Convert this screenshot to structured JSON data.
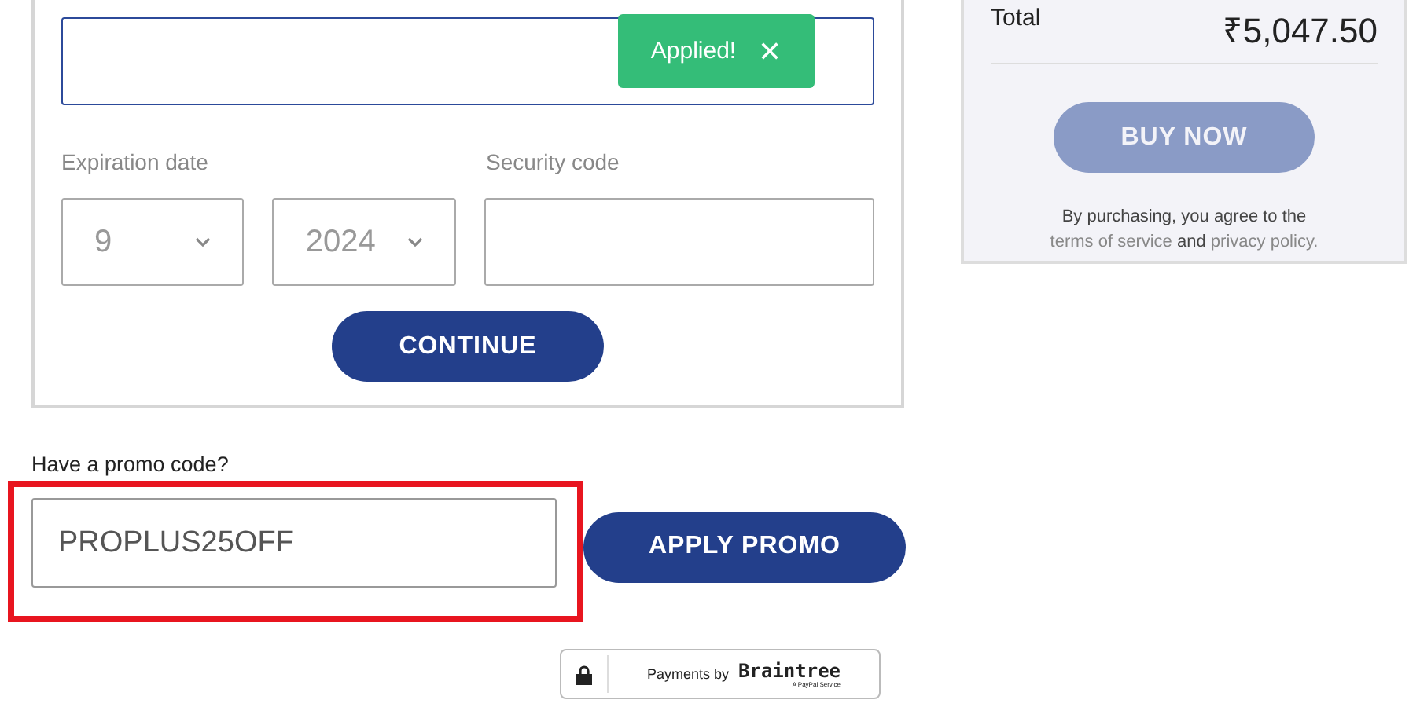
{
  "card_form": {
    "toast": {
      "text": "Applied!",
      "close": "✕"
    },
    "expiration_label": "Expiration date",
    "month": "9",
    "year": "2024",
    "security_label": "Security code",
    "continue_button": "CONTINUE"
  },
  "promo": {
    "label": "Have a promo code?",
    "value": "PROPLUS25OFF",
    "highlighted": true,
    "apply_button": "APPLY PROMO"
  },
  "badge": {
    "prefix": "Payments by",
    "brand": "Braintree",
    "sub": "A PayPal Service"
  },
  "summary": {
    "total_label": "Total",
    "total": "₹5,047.50",
    "buy_button": "BUY NOW",
    "buy_disabled": true,
    "agree": "By purchasing, you agree to the",
    "terms": "terms of service",
    "and": "and",
    "privacy": "privacy policy."
  }
}
